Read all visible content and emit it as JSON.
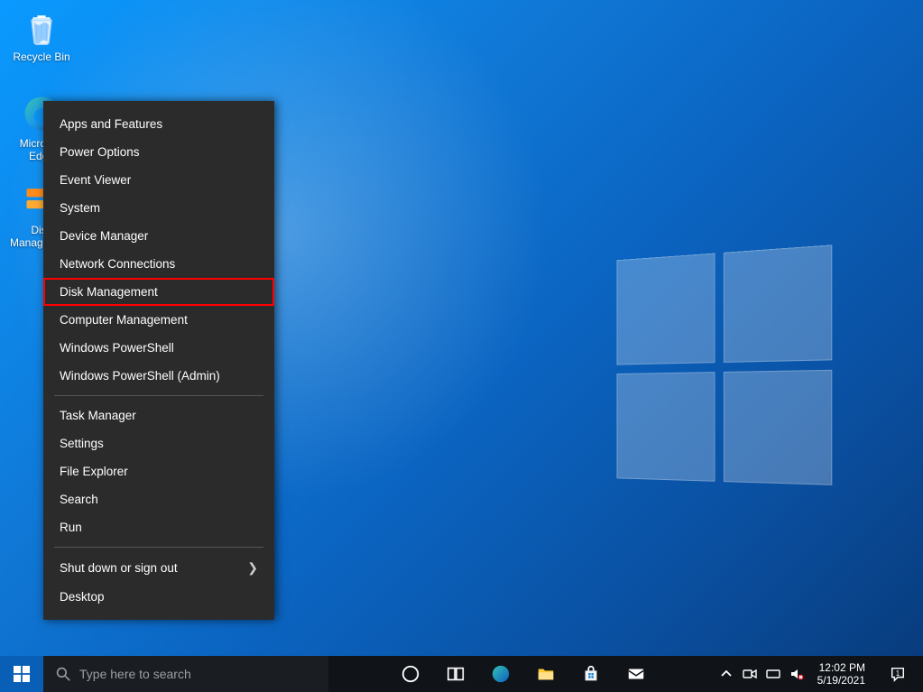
{
  "desktop": {
    "icons": {
      "recycle_bin": "Recycle Bin",
      "edge": "Microsoft Edge",
      "disk_management": "Disk Management"
    }
  },
  "winx_menu": {
    "items": [
      "Apps and Features",
      "Power Options",
      "Event Viewer",
      "System",
      "Device Manager",
      "Network Connections",
      "Disk Management",
      "Computer Management",
      "Windows PowerShell",
      "Windows PowerShell (Admin)"
    ],
    "group2": [
      "Task Manager",
      "Settings",
      "File Explorer",
      "Search",
      "Run"
    ],
    "group3": [
      "Shut down or sign out",
      "Desktop"
    ],
    "highlighted": "Disk Management"
  },
  "taskbar": {
    "search_placeholder": "Type here to search",
    "clock_time": "12:02 PM",
    "clock_date": "5/19/2021",
    "notification_count": "1"
  }
}
